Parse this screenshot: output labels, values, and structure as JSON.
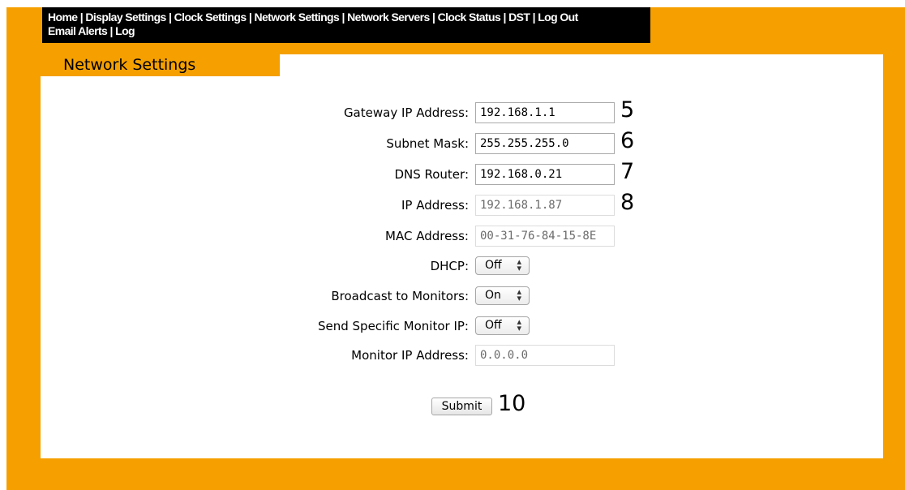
{
  "nav": {
    "items": [
      "Home",
      "Display Settings",
      "Clock Settings",
      "Network Settings",
      "Network Servers",
      "Clock Status",
      "DST",
      "Log Out",
      "Email Alerts",
      "Log"
    ],
    "separator": "|"
  },
  "page": {
    "title": "Network Settings"
  },
  "form": {
    "gateway": {
      "label": "Gateway IP Address:",
      "value": "192.168.1.1",
      "annotation": "5"
    },
    "subnet": {
      "label": "Subnet Mask:",
      "value": "255.255.255.0",
      "annotation": "6"
    },
    "dns": {
      "label": "DNS Router:",
      "value": "192.168.0.21",
      "annotation": "7"
    },
    "ip": {
      "label": "IP Address:",
      "value": "192.168.1.87",
      "annotation": "8"
    },
    "mac": {
      "label": "MAC Address:",
      "value": "00-31-76-84-15-8E"
    },
    "dhcp": {
      "label": "DHCP:",
      "value": "Off"
    },
    "broadcast": {
      "label": "Broadcast to Monitors:",
      "value": "On"
    },
    "specific": {
      "label": "Send Specific Monitor IP:",
      "value": "Off"
    },
    "monitor_ip": {
      "label": "Monitor IP Address:",
      "value": "0.0.0.0"
    },
    "submit": {
      "label": "Submit",
      "annotation": "10"
    }
  },
  "colors": {
    "frame": "#f5a000",
    "navbar": "#000000",
    "panel": "#ffffff"
  },
  "icons": {
    "select_arrows": "up-down-chevron-icon"
  }
}
